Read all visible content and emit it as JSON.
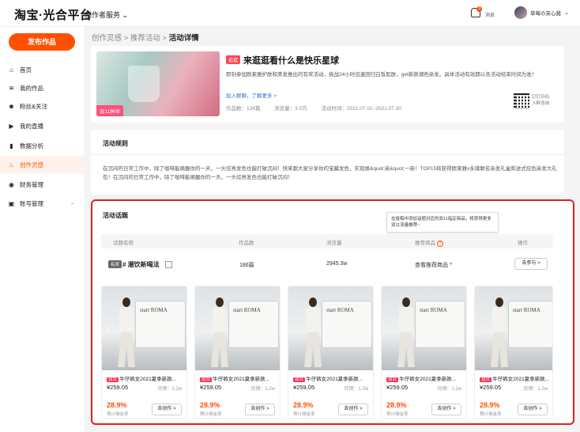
{
  "header": {
    "logo": "淘宝·光合平台",
    "service_menu": "创作者服务",
    "service_chevron": "⌄",
    "message_badge": "3",
    "message_label": "消息",
    "username": "草莓の夹心酱",
    "user_chevron": "⌄"
  },
  "sidebar": {
    "publish_label": "发布作品",
    "items": [
      {
        "label": "首页",
        "icon": "home-icon",
        "glyph": "⌂"
      },
      {
        "label": "我的作品",
        "icon": "layers-icon",
        "glyph": "≋"
      },
      {
        "label": "粉丝&关注",
        "icon": "users-icon",
        "glyph": "☻"
      },
      {
        "label": "我的直播",
        "icon": "video-icon",
        "glyph": "▶"
      },
      {
        "label": "数据分析",
        "icon": "bar-chart-icon",
        "glyph": "▮"
      },
      {
        "label": "创作灵感",
        "icon": "flame-icon",
        "glyph": "♨",
        "active": true
      },
      {
        "label": "财务管理",
        "icon": "finance-icon",
        "glyph": "◉"
      },
      {
        "label": "账号管理",
        "icon": "account-icon",
        "glyph": "▣",
        "expand": "⌄"
      }
    ]
  },
  "breadcrumb": {
    "item1": "创作灵感",
    "sep1": ">",
    "item2": "推荐活动",
    "sep2": ">",
    "current": "活动详情"
  },
  "activity": {
    "tag": "逛逛",
    "title": "来逛逛看什么是快乐星球",
    "banner_badge": "双11种草",
    "description": "即刻参加欧莱雅护肤和美发推出的有奖活动，挑战24小时迅速回归白皙肌肤，get新款潮色染发。具体活动有效期以各活动结束时间为准！",
    "join_link": "加入群聊，了解更多 >",
    "works_count": "作品数：134篇",
    "views": "浏览量：3.5万",
    "time": "活动时间：2021.07.01~2021.07.30",
    "qr_line1": "钉钉扫码",
    "qr_line2": "入群咨询"
  },
  "rules": {
    "title": "活动规则",
    "text": "在沉闷的日常工作中，除了咖啡能唤醒你的一天，一头炫亮发色也能打破沉闷！快来跟大家分享你的宝藏发色，实现焕&quot;染&quot;一新！TOP15将获得欧莱雅x永璞联名染发礼盒和送式炫色染发大礼包！在沉闷的日常工作中，除了咖啡能唤醒你的一天，一头炫亮发色也能打破沉闷！"
  },
  "topics": {
    "title": "活动话题",
    "tooltip": "在投稿中添加话题对应的双11指定商品，将获得更多双11流量推荐~",
    "columns": {
      "name": "话题名称",
      "works": "作品数",
      "views": "浏览量",
      "products": "推荐商品",
      "products_help": "?",
      "action": "操作"
    },
    "row": {
      "reward_tag": "有奖",
      "name": "# 潮饮新喝法",
      "works": "186篇",
      "views": "2945.3w",
      "products_link": "查看推荐商品",
      "products_toggle": "^",
      "join_button": "去参与 >"
    }
  },
  "products": [
    {
      "tag": "双11",
      "title": "牛仔裤女2021夏季新款...",
      "price": "¥259.05",
      "sales": "月销：1.2w",
      "rate": "28.9%",
      "rate_label": "预计佣金率",
      "button": "去创作 >",
      "brand": "start ROMA"
    },
    {
      "tag": "双11",
      "title": "牛仔裤女2021夏季新款...",
      "price": "¥259.05",
      "sales": "月销：1.2w",
      "rate": "28.9%",
      "rate_label": "预计佣金率",
      "button": "去创作 >",
      "brand": "start ROMA"
    },
    {
      "tag": "双11",
      "title": "牛仔裤女2021夏季新款...",
      "price": "¥259.05",
      "sales": "月销：1.2w",
      "rate": "28.9%",
      "rate_label": "预计佣金率",
      "button": "去创作 >",
      "brand": "start ROMA"
    },
    {
      "tag": "双11",
      "title": "牛仔裤女2021夏季新款...",
      "price": "¥259.05",
      "sales": "月销：1.2w",
      "rate": "28.9%",
      "rate_label": "预计佣金率",
      "button": "去创作 >",
      "brand": "start ROMA"
    },
    {
      "tag": "双11",
      "title": "牛仔裤女2021夏季新款...",
      "price": "¥259.05",
      "sales": "月销：1.2w",
      "rate": "28.9%",
      "rate_label": "预计佣金率",
      "button": "去创作 >",
      "brand": "start ROMA"
    }
  ],
  "carousel": {
    "prev": "‹",
    "next": "›"
  },
  "colors": {
    "accent": "#ff5000",
    "highlight_border": "#e02020",
    "tag_red": "#ff3355"
  }
}
